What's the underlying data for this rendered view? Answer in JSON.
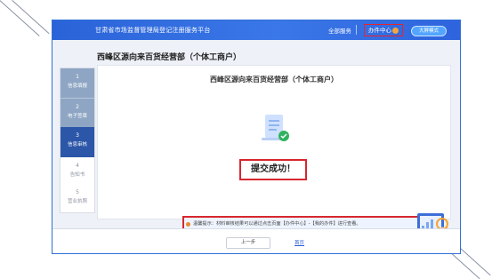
{
  "header": {
    "site_title": "甘肃省市场监督管理局登记注册服务平台",
    "nav_all_services": "全部服务",
    "nav_office": "办件中心",
    "mode_button": "大屏模式"
  },
  "page_title": "西峰区源向来百货经营部（个体工商户）",
  "steps": [
    {
      "num": "1",
      "label": "信息填报",
      "state": "done"
    },
    {
      "num": "2",
      "label": "电子签章",
      "state": "done"
    },
    {
      "num": "3",
      "label": "信息审核",
      "state": "active"
    },
    {
      "num": "4",
      "label": "告知书",
      "state": "pending"
    },
    {
      "num": "5",
      "label": "营业执照",
      "state": "pending"
    }
  ],
  "card": {
    "title": "西峰区源向来百货经营部（个体工商户）",
    "success_text": "提交成功！",
    "tip": "温馨提示：材料审核结果可以通过点击页面【办件中心】-【我的办件】进行查看。"
  },
  "footer": {
    "prev_button": "上一步",
    "home_link": "首页"
  },
  "colors": {
    "brand_blue": "#2a63d8",
    "highlight_red": "#d8262e",
    "step_active": "#2c56a8",
    "step_done": "#8ea6c4"
  },
  "icons": {
    "doc": "document-check-icon",
    "illustration": "analysis-illustration-icon",
    "badge": "notification-badge-icon"
  }
}
